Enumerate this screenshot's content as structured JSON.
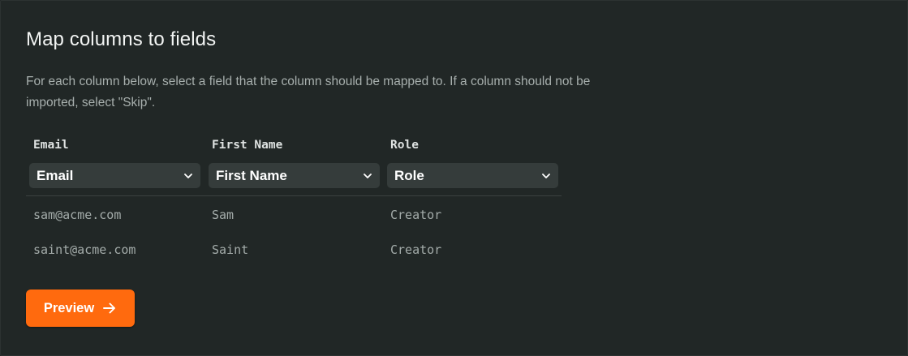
{
  "page": {
    "title": "Map columns to fields",
    "description": "For each column below, select a field that the column should be mapped to. If a column should not be imported, select \"Skip\"."
  },
  "columns": [
    {
      "header": "Email",
      "selected": "Email"
    },
    {
      "header": "First Name",
      "selected": "First Name"
    },
    {
      "header": "Role",
      "selected": "Role"
    }
  ],
  "rows": [
    [
      "sam@acme.com",
      "Sam",
      "Creator"
    ],
    [
      "saint@acme.com",
      "Saint",
      "Creator"
    ]
  ],
  "actions": {
    "preview_label": "Preview"
  },
  "icons": {
    "select_chevron": "chevron-down-icon",
    "preview_arrow": "arrow-right-icon"
  },
  "colors": {
    "accent": "#ff6a0e",
    "background": "#212726",
    "select_background": "#353c3b"
  }
}
